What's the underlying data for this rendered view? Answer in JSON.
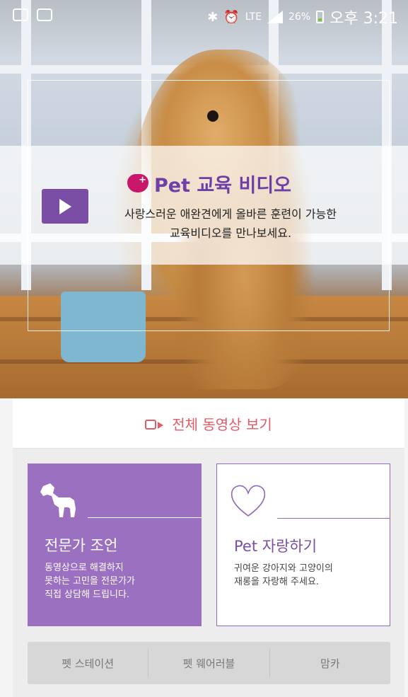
{
  "status_bar": {
    "battery": "26%",
    "network": "LTE",
    "time": "오후 3:21",
    "icons": [
      "app-icon",
      "image-icon",
      "bluetooth-icon",
      "alarm-icon",
      "lte-icon",
      "signal-icon",
      "battery-icon"
    ]
  },
  "hero": {
    "title": "Pet 교육 비디오",
    "description_line1": "사랑스러운 애완견에게 올바른 훈련이 가능한",
    "description_line2": "교육비디오를 만나보세요."
  },
  "all_videos": {
    "label": "전체 동영상 보기",
    "icon": "video-camera-icon",
    "color": "#e15a66"
  },
  "cards": {
    "expert": {
      "title": "전문가 조언",
      "text_line1": "동영상으로 해결하지",
      "text_line2": "못하는 고민을 전문가가",
      "text_line3": "직접 상담해 드립니다.",
      "icon": "dog-icon",
      "color": "#9b70c1"
    },
    "pet": {
      "title": "Pet 자랑하기",
      "text_line1": "귀여운 강아지와 고양이의",
      "text_line2": "재롱을 자랑해 주세요.",
      "icon": "heart-icon"
    }
  },
  "tabs": [
    "펫 스테이션",
    "펫 웨어러블",
    "맘카"
  ],
  "colors": {
    "accent": "#7b4ea6",
    "brand": "#c8176b"
  }
}
